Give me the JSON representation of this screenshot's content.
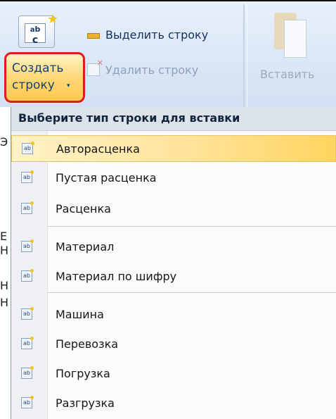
{
  "ribbon": {
    "create_icon_label": "a/b c",
    "create_button": {
      "line1": "Создать",
      "line2": "строку",
      "arrow": "▾"
    },
    "select_row_label": "Выделить строку",
    "delete_row_label": "Удалить строку",
    "paste_label": "Вставить"
  },
  "edge_chars": [
    "Ь",
    "Е",
    "Е",
    "Ь",
    "Н",
    "Е",
    "ы"
  ],
  "menu": {
    "header": "Выберите тип строки для вставки",
    "items": [
      {
        "label": "Авторасценка"
      },
      {
        "label": "Пустая расценка"
      },
      {
        "label": "Расценка"
      },
      {
        "label": "Материал"
      },
      {
        "label": "Материал по шифру"
      },
      {
        "label": "Машина"
      },
      {
        "label": "Перевозка"
      },
      {
        "label": "Погрузка"
      },
      {
        "label": "Разгрузка"
      }
    ],
    "highlighted_index": 0
  },
  "colors": {
    "highlight": "#ffd45f",
    "create_border": "#e21b1b",
    "ribbon": "#dbe7f6"
  }
}
